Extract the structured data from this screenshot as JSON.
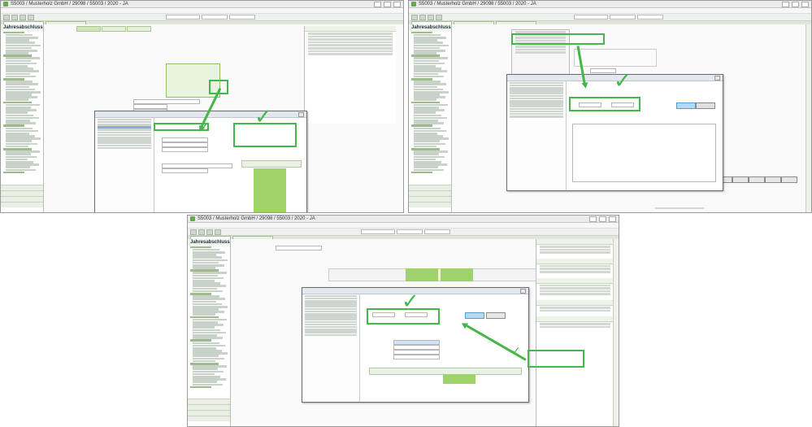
{
  "windows": [
    {
      "title": "S5003 / Musterholz GmbH / 29098 / 55003 / 2020 - JA",
      "sidebar_header": "Jahresabschluss"
    },
    {
      "title": "S5003 / Musterholz GmbH / 29098 / 55003 / 2020 - JA",
      "sidebar_header": "Jahresabschluss"
    },
    {
      "title": "S5003 / Musterholz GmbH / 29098 / 55003 / 2020 - JA",
      "sidebar_header": "Jahresabschluss"
    }
  ],
  "colors": {
    "accent": "#47b64a",
    "sidebar_folder": "#9fb98f",
    "highlight_fill": "#e8f4dd",
    "primary_button": "#b6d9f2"
  },
  "icons": [
    "app-logo-icon",
    "checkmark-icon",
    "arrow-icon",
    "folder-icon",
    "close-icon"
  ]
}
